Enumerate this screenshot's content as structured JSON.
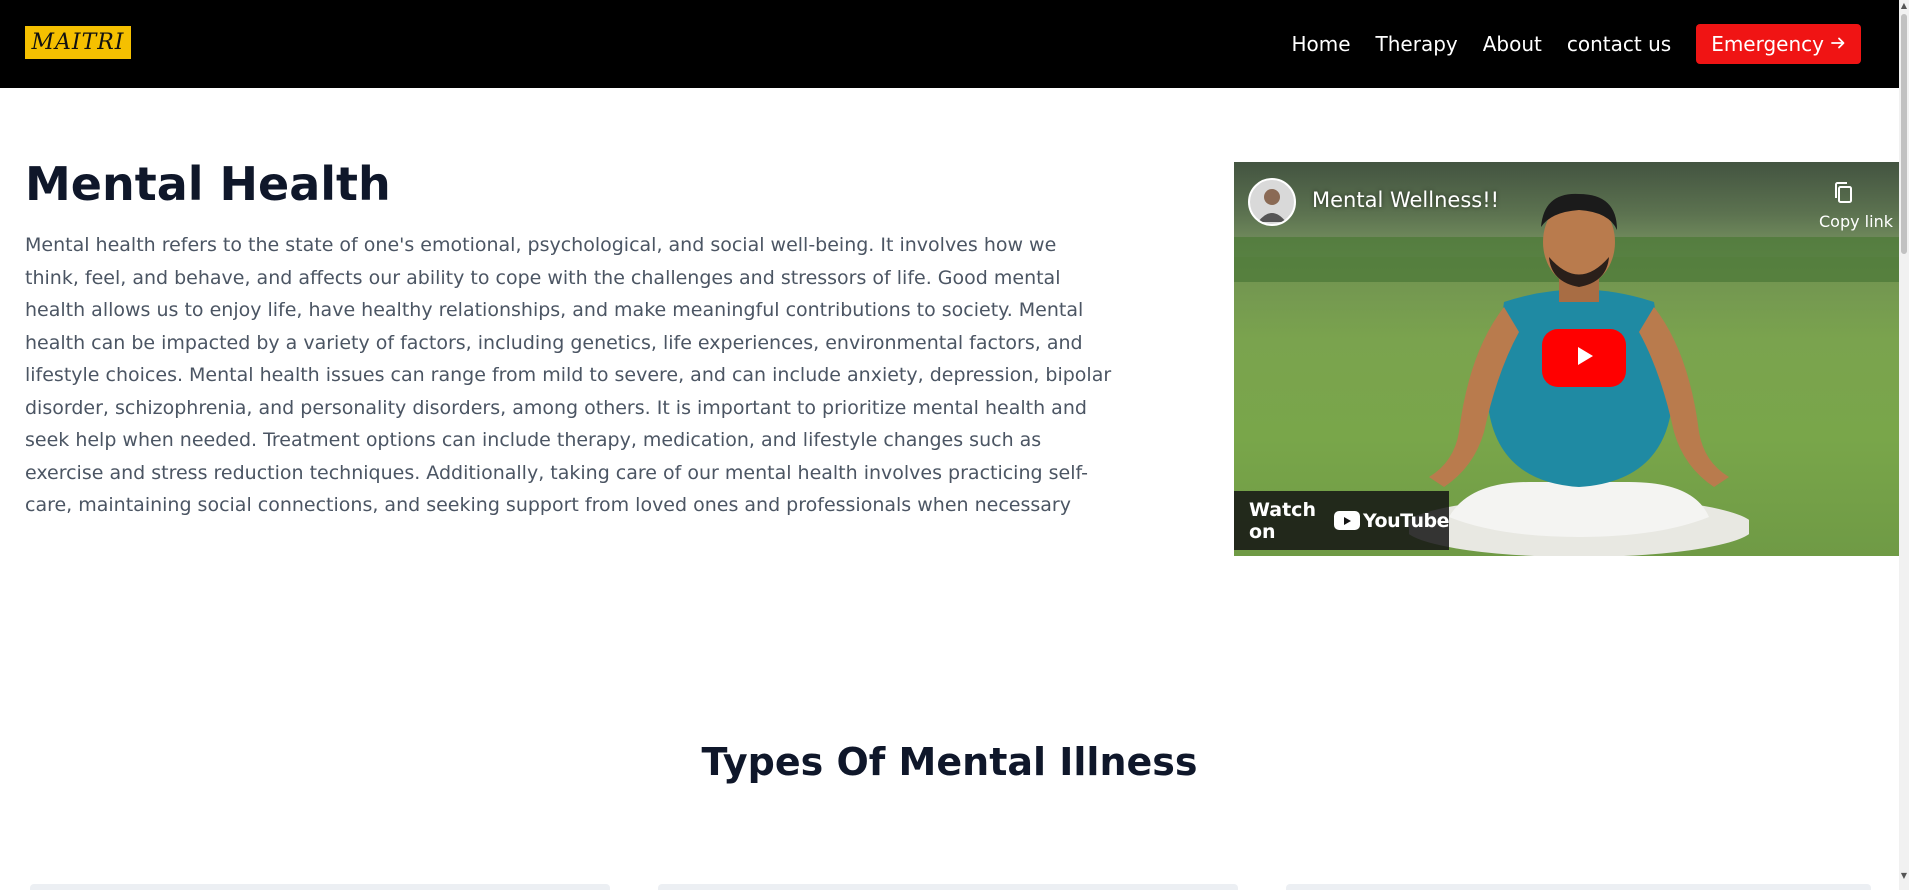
{
  "nav": {
    "logo": "MAITRI",
    "links": [
      "Home",
      "Therapy",
      "About",
      "contact us"
    ],
    "emergency_label": "Emergency",
    "emergency_icon": "arrow-right-icon"
  },
  "hero": {
    "title": "Mental Health",
    "description": "Mental health refers to the state of one's emotional, psychological, and social well-being. It involves how we think, feel, and behave, and affects our ability to cope with the challenges and stressors of life. Good mental health allows us to enjoy life, have healthy relationships, and make meaningful contributions to society. Mental health can be impacted by a variety of factors, including genetics, life experiences, environmental factors, and lifestyle choices. Mental health issues can range from mild to severe, and can include anxiety, depression, bipolar disorder, schizophrenia, and personality disorders, among others. It is important to prioritize mental health and seek help when needed. Treatment options can include therapy, medication, and lifestyle changes such as exercise and stress reduction techniques. Additionally, taking care of our mental health involves practicing self-care, maintaining social connections, and seeking support from loved ones and professionals when necessary"
  },
  "video": {
    "title": "Mental Wellness!!",
    "copy_label": "Copy link",
    "watch_label": "Watch on",
    "brand": "YouTube"
  },
  "section": {
    "title": "Types Of Mental Illness"
  },
  "colors": {
    "nav_bg": "#000000",
    "logo_bg": "#f5c000",
    "emergency_bg": "#f01414",
    "play_button": "#ff0000",
    "heading": "#0f172a",
    "body_text": "#4b5563"
  }
}
